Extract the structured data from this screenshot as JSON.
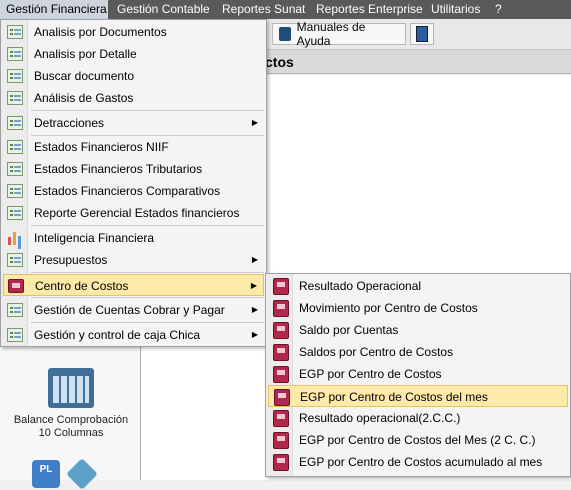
{
  "menubar": {
    "items": [
      {
        "label": "Gestión Financiera"
      },
      {
        "label": "Gestión Contable"
      },
      {
        "label": "Reportes Sunat"
      },
      {
        "label": "Reportes Enterprise"
      },
      {
        "label": "Utilitarios"
      },
      {
        "label": "?"
      }
    ]
  },
  "toolbar": {
    "manuales_label": "Manuales de Ayuda"
  },
  "background": {
    "header_fragment": "ctos",
    "balance_tile_label": "Balance Comprobación 10 Columnas",
    "pl_icon_text": "PL"
  },
  "main_menu": {
    "items": [
      {
        "label": "Analisis por Documentos",
        "icon": "document-list-icon"
      },
      {
        "label": "Analisis por Detalle",
        "icon": "document-list-icon"
      },
      {
        "label": "Buscar documento",
        "icon": "document-list-icon"
      },
      {
        "label": "Análisis de Gastos",
        "icon": "document-list-icon"
      },
      {
        "label": "Detracciones",
        "icon": "document-list-icon",
        "submenu": true
      },
      {
        "label": "Estados Financieros NIIF",
        "icon": "document-list-icon"
      },
      {
        "label": "Estados Financieros Tributarios",
        "icon": "document-list-icon"
      },
      {
        "label": "Estados Financieros Comparativos",
        "icon": "document-list-icon"
      },
      {
        "label": "Reporte Gerencial Estados financieros",
        "icon": "document-list-icon"
      },
      {
        "label": "Inteligencia Financiera",
        "icon": "bar-chart-icon"
      },
      {
        "label": "Presupuestos",
        "icon": "document-list-icon",
        "submenu": true
      },
      {
        "label": "Centro de Costos",
        "icon": "book-icon",
        "submenu": true,
        "highlighted": true
      },
      {
        "label": "Gestión de Cuentas Cobrar y Pagar",
        "icon": "document-list-icon",
        "submenu": true
      },
      {
        "label": "Gestión y control de caja Chica",
        "icon": "document-list-icon",
        "submenu": true
      }
    ]
  },
  "submenu_centro_costos": {
    "items": [
      {
        "label": "Resultado Operacional"
      },
      {
        "label": "Movimiento por Centro de Costos"
      },
      {
        "label": "Saldo por Cuentas"
      },
      {
        "label": "Saldos por Centro de Costos"
      },
      {
        "label": "EGP por Centro de Costos"
      },
      {
        "label": "EGP por Centro de Costos del mes",
        "highlighted": true
      },
      {
        "label": "Resultado operacional(2.C.C.)"
      },
      {
        "label": "EGP por Centro de Costos del Mes (2 C. C.)"
      },
      {
        "label": "EGP por Centro de Costos acumulado al mes"
      }
    ]
  },
  "colors": {
    "menubar_bg": "#5a5a5a",
    "highlight_bg": "#fde9a8",
    "book_icon": "#b0294a"
  }
}
